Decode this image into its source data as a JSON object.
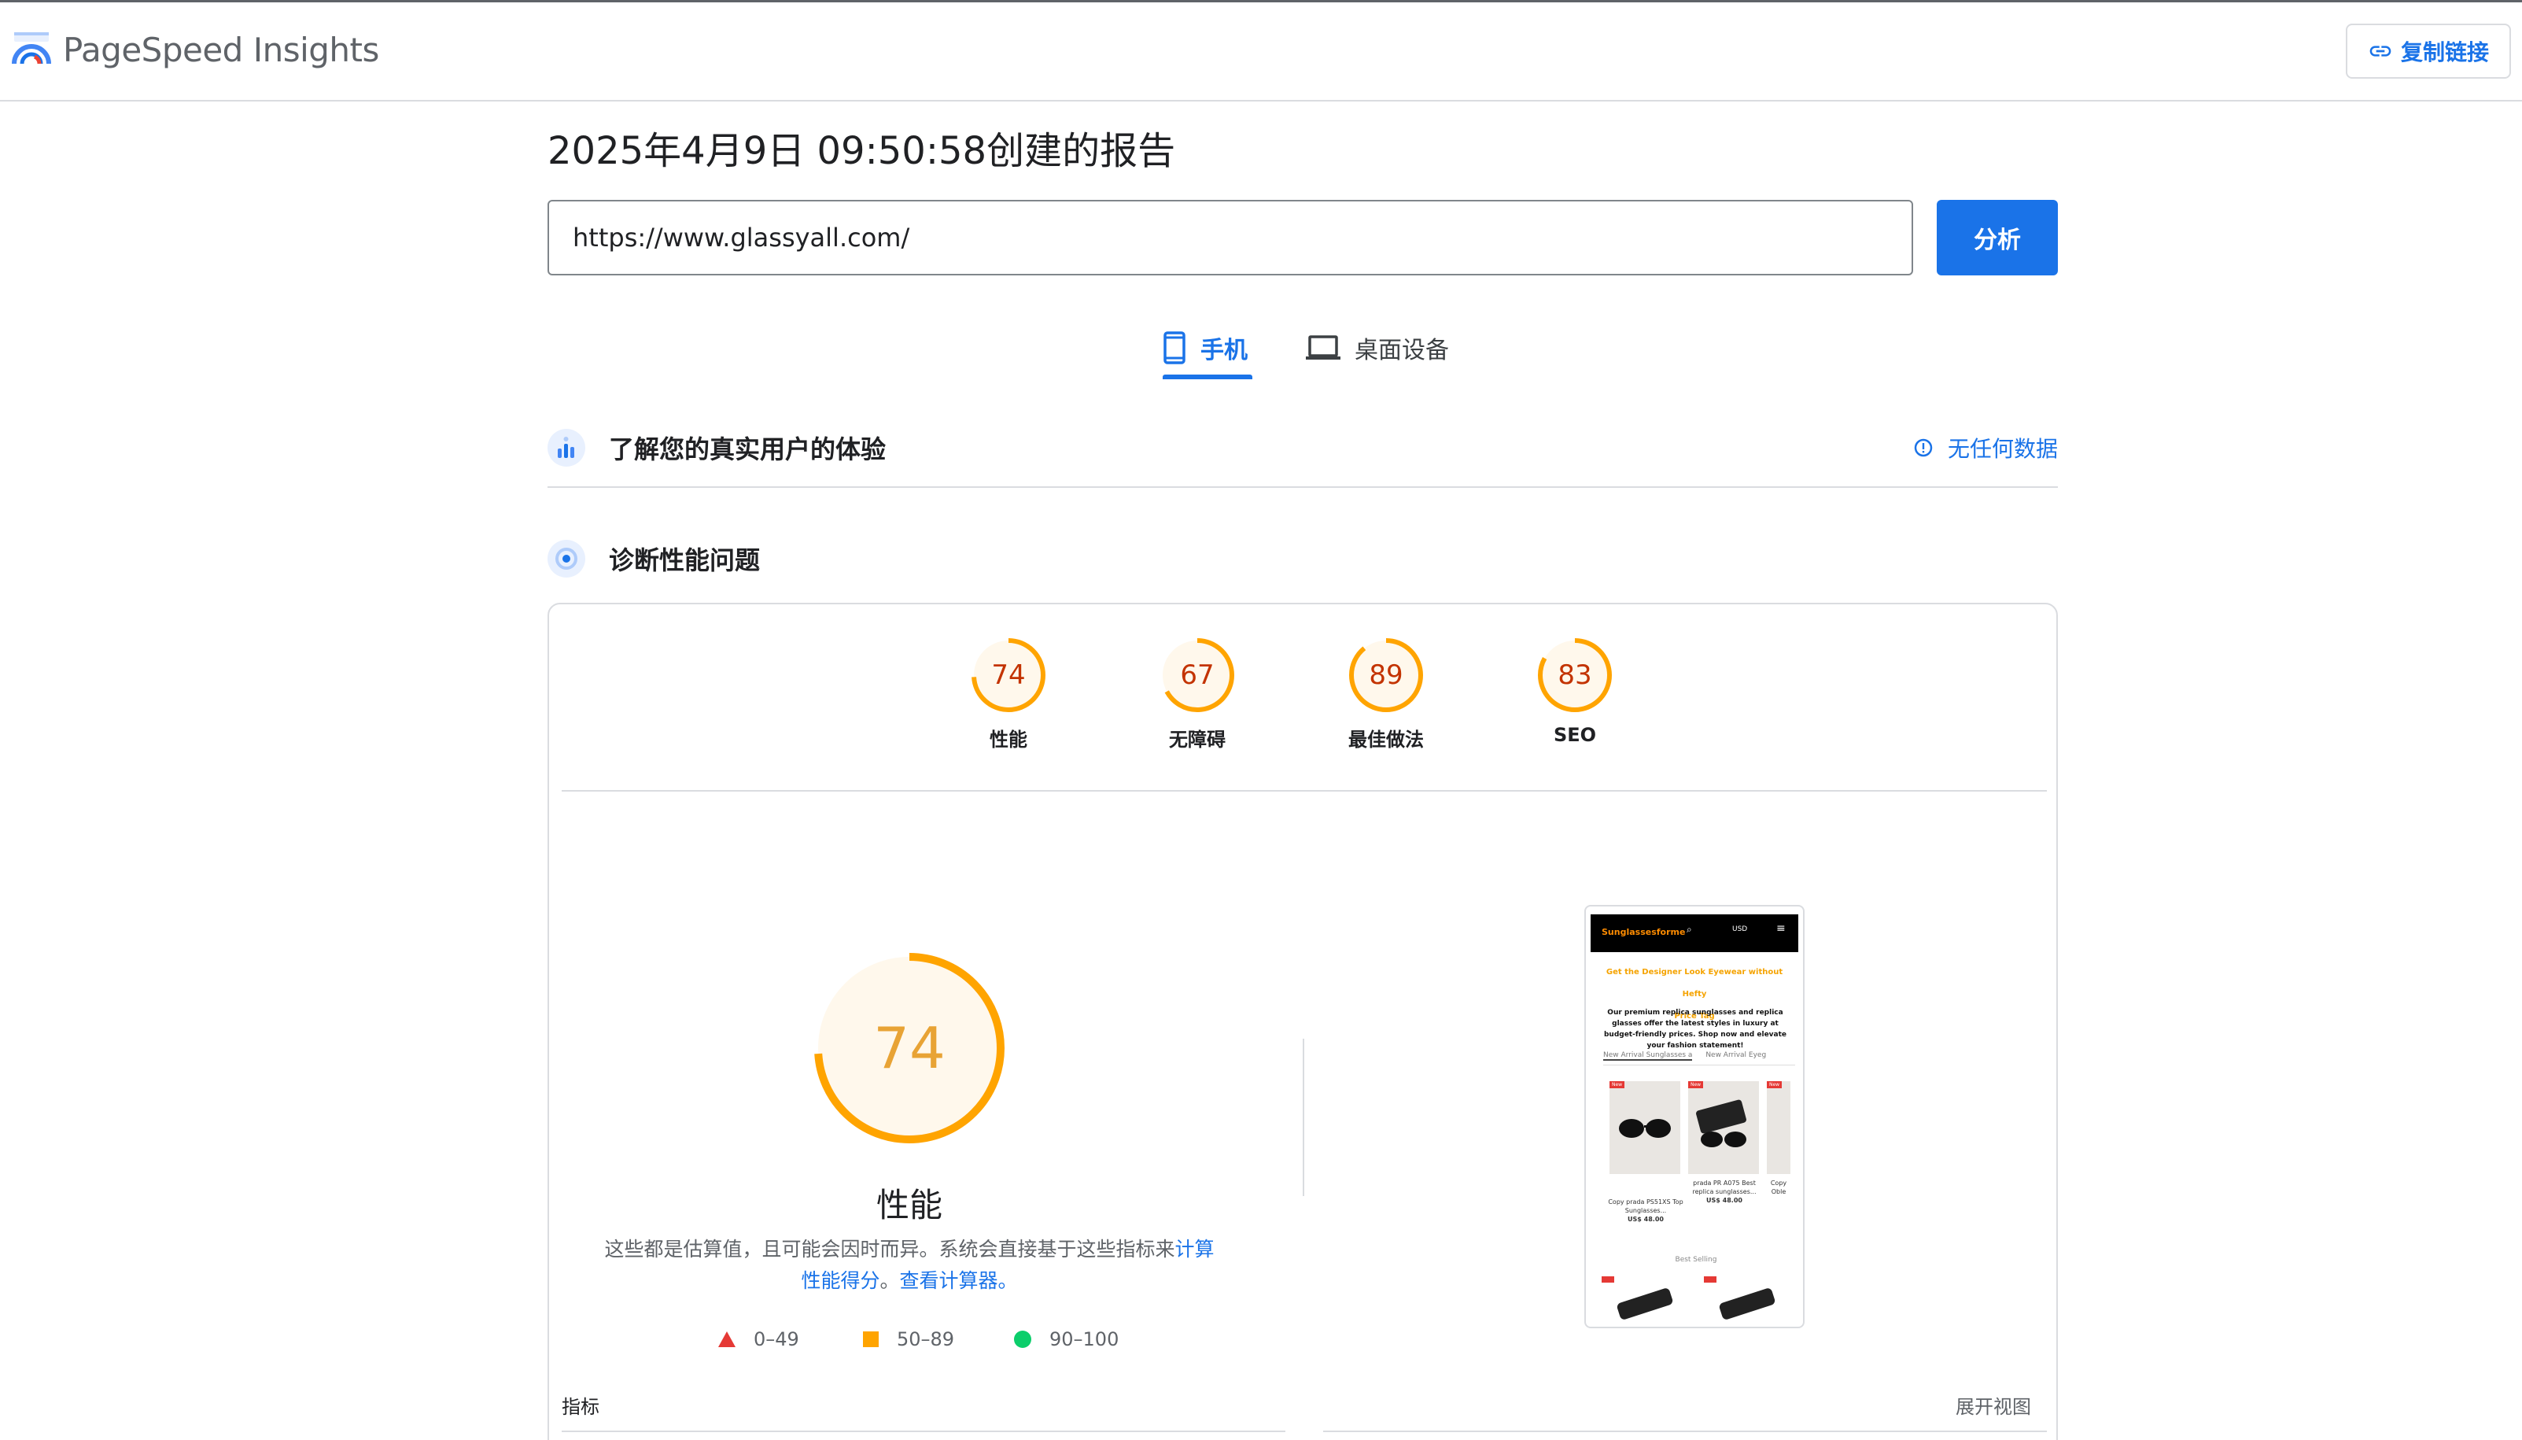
{
  "header": {
    "brand": "PageSpeed Insights",
    "copy_link_label": "复制链接",
    "logo_icon": "pagespeed-logo-icon",
    "link_icon": "link-icon"
  },
  "report": {
    "title": "2025年4月9日 09:50:58创建的报告",
    "url_value": "https://www.glassyall.com/",
    "analyze_label": "分析"
  },
  "tabs": [
    {
      "label": "手机",
      "icon": "phone-icon",
      "active": true
    },
    {
      "label": "桌面设备",
      "icon": "laptop-icon",
      "active": false
    }
  ],
  "crux": {
    "title": "了解您的真实用户的体验",
    "status": "无任何数据",
    "icon": "real-user-experience-icon",
    "status_icon": "info-icon"
  },
  "diagnose": {
    "title": "诊断性能问题",
    "icon": "diagnose-icon"
  },
  "scores": [
    {
      "label": "性能",
      "value": "74"
    },
    {
      "label": "无障碍",
      "value": "67"
    },
    {
      "label": "最佳做法",
      "value": "89"
    },
    {
      "label": "SEO",
      "value": "83"
    }
  ],
  "performance": {
    "score": "74",
    "label": "性能",
    "disclaimer_text": "这些都是估算值，且可能会因时而异。系统会直接基于这些指标来",
    "calc_link": "计算性能得分",
    "disclaimer_mid": "。",
    "calculator_link": "查看计算器。"
  },
  "legend": [
    {
      "range": "0–49",
      "shape": "triangle",
      "color": "#e53935"
    },
    {
      "range": "50–89",
      "shape": "square",
      "color": "#ffa400"
    },
    {
      "range": "90–100",
      "shape": "circle",
      "color": "#0cce6b"
    }
  ],
  "colors": {
    "accent": "#1a73e8",
    "average": "#ffa400",
    "average_text": "#c33300",
    "big_score_text": "#e8a335"
  },
  "screenshot": {
    "site_name": "Sunglassesforme",
    "currency": "USD",
    "headline_1": "Get the Designer Look Eyewear without Hefty",
    "headline_2": "Price Tag",
    "paragraph": "Our premium replica sunglasses and replica glasses offer the latest styles in luxury at budget-friendly prices. Shop now and elevate your fashion statement!",
    "tab_1": "New Arrival Sunglasses a",
    "tab_2": "New Arrival Eyeg",
    "product_1": "Copy prada PS51XS Top Sunglasses...",
    "price_1": "US$ 48.00",
    "product_2": "prada PR A075 Best replica sunglasses...",
    "price_2": "US$ 48.00",
    "product_3": "Copy Oble",
    "best_selling": "Best Selling",
    "badge": "New"
  },
  "metrics": {
    "label": "指标",
    "expand_view": "展开视图"
  }
}
